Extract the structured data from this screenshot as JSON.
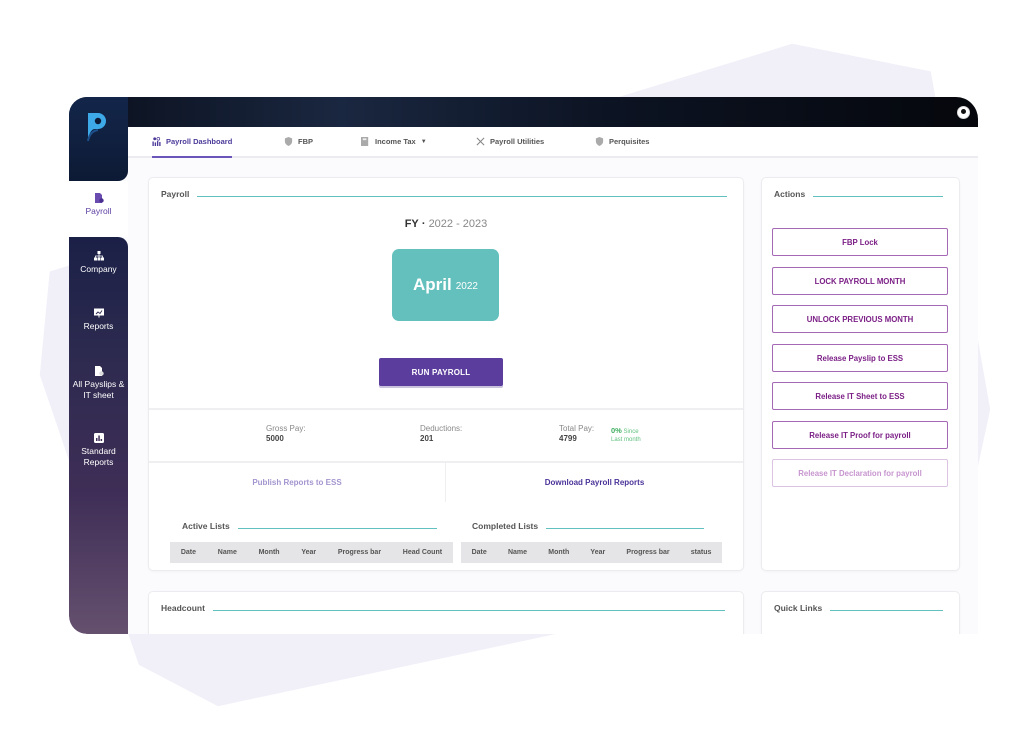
{
  "brand": {
    "accent": "#5b3d9e",
    "teal": "#63c0bd",
    "action_color": "#7b1f86"
  },
  "topbar": {
    "user_icon": "user-circle-icon"
  },
  "sidebar": {
    "items": [
      {
        "label": "Payroll",
        "icon": "payroll-doc-icon",
        "active": true
      },
      {
        "label": "Company",
        "icon": "org-chart-icon"
      },
      {
        "label": "Reports",
        "icon": "presentation-chart-icon"
      },
      {
        "label": "All Payslips & IT sheet",
        "icon": "payslip-doc-icon"
      },
      {
        "label": "Standard Reports",
        "icon": "bar-chart-icon"
      }
    ]
  },
  "tabs": [
    {
      "label": "Payroll Dashboard",
      "icon": "dashboard-people-icon",
      "active": true
    },
    {
      "label": "FBP",
      "icon": "shield-icon"
    },
    {
      "label": "Income Tax",
      "icon": "calculator-icon",
      "dropdown": true
    },
    {
      "label": "Payroll Utilities",
      "icon": "tools-icon"
    },
    {
      "label": "Perquisites",
      "icon": "shield-icon"
    }
  ],
  "payroll": {
    "title": "Payroll",
    "fy_label": "FY",
    "fy_sep": "·",
    "fy_range": "2022 - 2023",
    "month": "April",
    "year": "2022",
    "run_button": "RUN PAYROLL",
    "stats": {
      "gross_label": "Gross Pay:",
      "gross_value": "5000",
      "deductions_label": "Deductions:",
      "deductions_value": "201",
      "total_label": "Total Pay:",
      "total_value": "4799",
      "growth_pct": "0%",
      "growth_since": "Since",
      "growth_period": "Last month"
    },
    "publish_link": "Publish Reports to ESS",
    "download_link": "Download Payroll Reports",
    "active_lists": {
      "title": "Active Lists",
      "columns": [
        "Date",
        "Name",
        "Month",
        "Year",
        "Progress bar",
        "Head Count"
      ]
    },
    "completed_lists": {
      "title": "Completed Lists",
      "columns": [
        "Date",
        "Name",
        "Month",
        "Year",
        "Progress bar",
        "status"
      ]
    }
  },
  "actions": {
    "title": "Actions",
    "buttons": [
      {
        "label": "FBP Lock"
      },
      {
        "label": "LOCK PAYROLL MONTH"
      },
      {
        "label": "UNLOCK PREVIOUS MONTH"
      },
      {
        "label": "Release Payslip to ESS"
      },
      {
        "label": "Release IT Sheet to ESS"
      },
      {
        "label": "Release IT Proof for payroll"
      },
      {
        "label": "Release IT Declaration for payroll",
        "disabled": true
      }
    ]
  },
  "headcount": {
    "title": "Headcount"
  },
  "quick_links": {
    "title": "Quick Links"
  }
}
